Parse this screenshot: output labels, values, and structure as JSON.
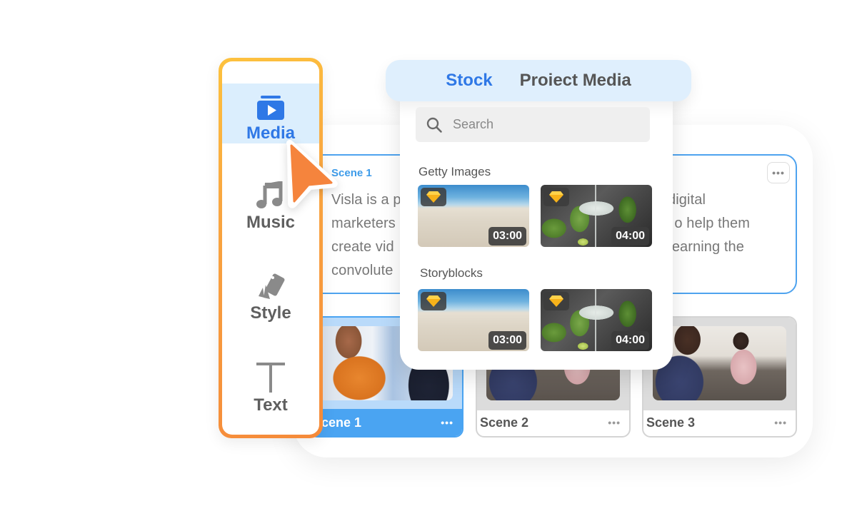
{
  "sidebar": {
    "items": [
      {
        "label": "Media",
        "icon": "media-play-icon",
        "active": true
      },
      {
        "label": "Music",
        "icon": "music-note-icon",
        "active": false
      },
      {
        "label": "Style",
        "icon": "style-swatch-icon",
        "active": false
      },
      {
        "label": "Text",
        "icon": "text-t-icon",
        "active": false
      }
    ]
  },
  "stock_panel": {
    "tabs": [
      {
        "label": "Stock",
        "active": true
      },
      {
        "label": "Proiect Media",
        "active": false
      }
    ],
    "search": {
      "placeholder": "Search",
      "value": ""
    },
    "sections": [
      {
        "title": "Getty Images",
        "items": [
          {
            "thumbnail": "beach",
            "premium": true,
            "duration": "03:00"
          },
          {
            "thumbnail": "cocktail",
            "premium": true,
            "duration": "04:00"
          }
        ]
      },
      {
        "title": "Storyblocks",
        "items": [
          {
            "thumbnail": "beach",
            "premium": true,
            "duration": "03:00"
          },
          {
            "thumbnail": "cocktail",
            "premium": true,
            "duration": "04:00"
          }
        ]
      }
    ]
  },
  "scene_editor": {
    "label": "Scene 1",
    "text": "Visla is a platform for digital marketers, providing tools to help them create videos without learning the convoluted",
    "visible_left": [
      "Visla is a p",
      "marketers",
      "create vid",
      "convolute"
    ],
    "visible_right": [
      "digital",
      "o help them",
      "earning the"
    ],
    "more": "•••"
  },
  "scenes": [
    {
      "name": "Scene 1",
      "active": true,
      "more": "•••"
    },
    {
      "name": "Scene 2",
      "active": false,
      "more": "•••"
    },
    {
      "name": "Scene 3",
      "active": false,
      "more": "•••"
    }
  ],
  "colors": {
    "accent_blue": "#2f78e6",
    "scene_blue": "#4aa4f2",
    "sidebar_border_start": "#fdc23e",
    "sidebar_border_end": "#f58a3a",
    "cursor_orange": "#f5843d",
    "premium_gold": "#f7b21a"
  }
}
